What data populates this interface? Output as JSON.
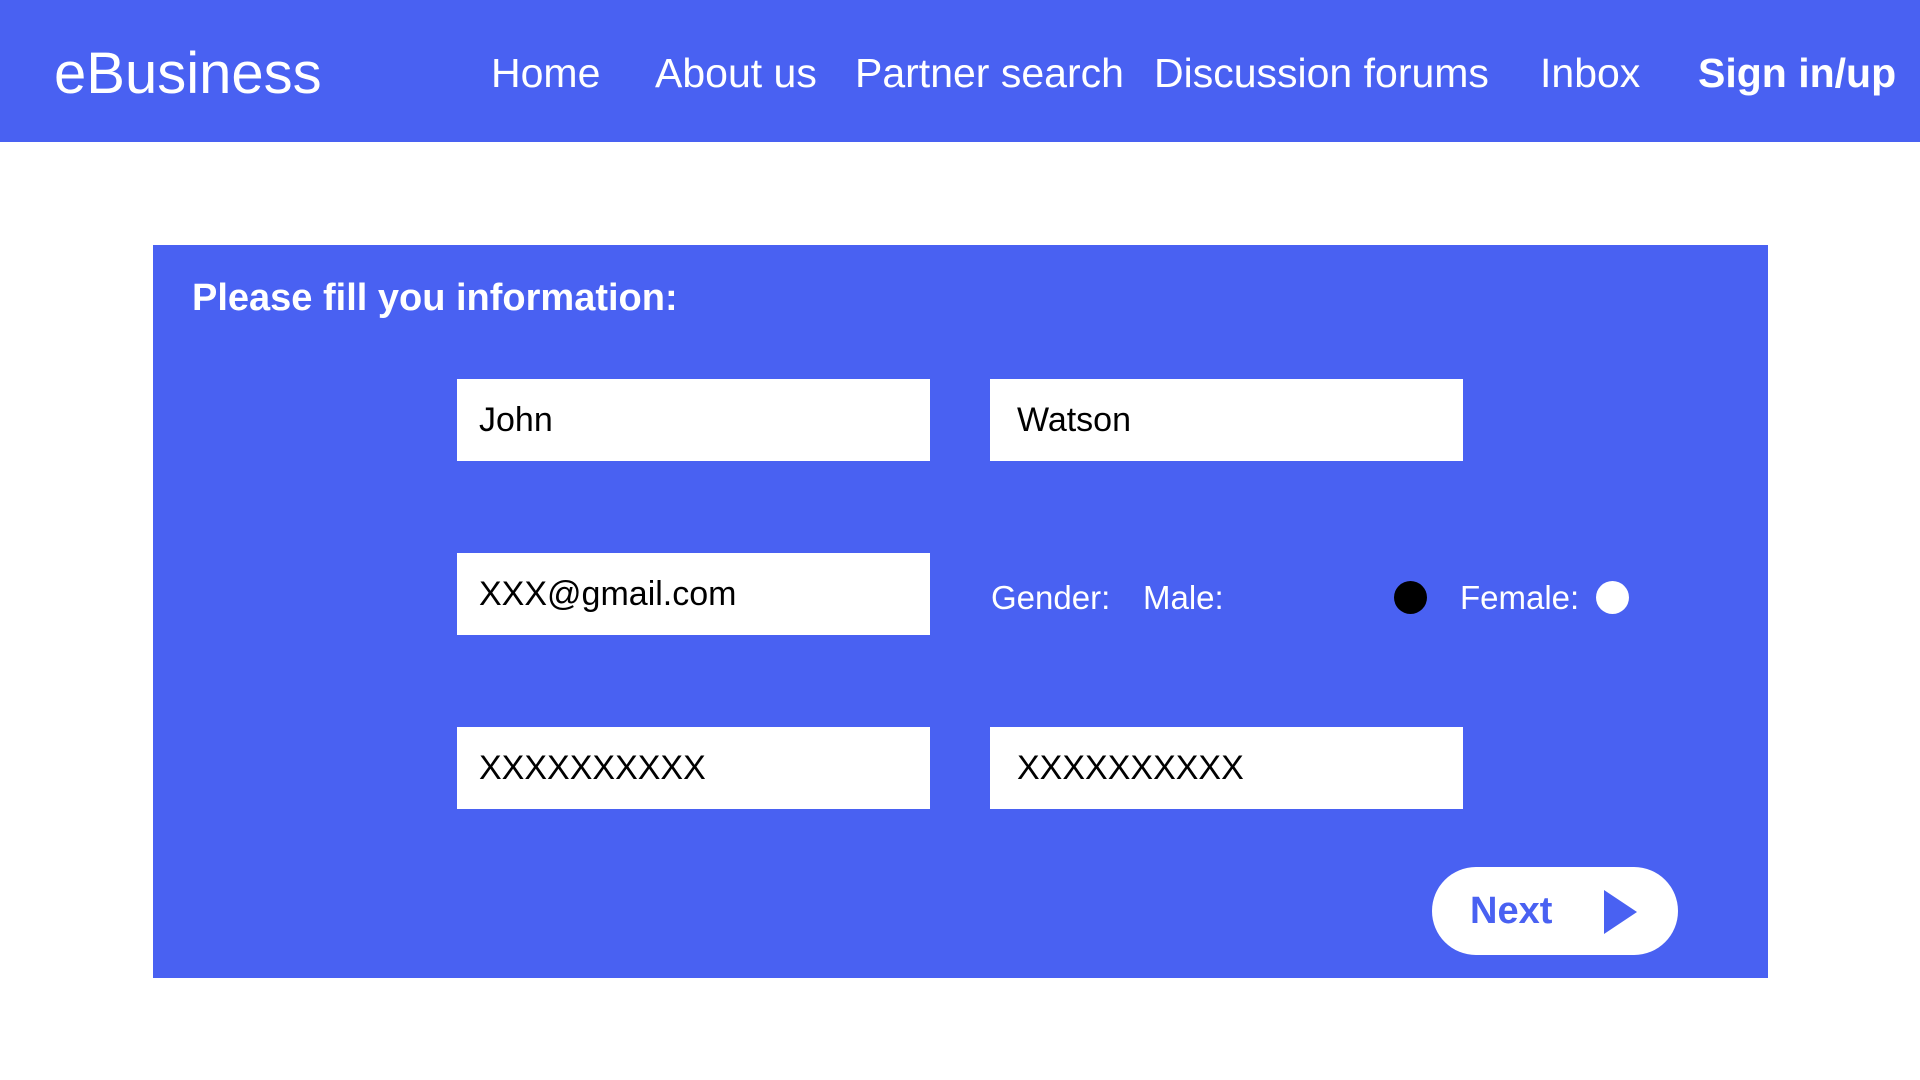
{
  "app": {
    "brand": "eBusiness"
  },
  "nav": {
    "items": [
      {
        "label": "Home"
      },
      {
        "label": "About us"
      },
      {
        "label": "Partner search"
      },
      {
        "label": "Discussion forums"
      },
      {
        "label": "Inbox"
      },
      {
        "label": "Sign in/up"
      }
    ]
  },
  "form": {
    "title": "Please fill you information:",
    "first_name": "John",
    "last_name": "Watson",
    "email": "XXX@gmail.com",
    "gender_label": "Gender:",
    "male_label": "Male:",
    "female_label": "Female:",
    "gender_selected": "male",
    "field_5": "XXXXXXXXXX",
    "field_6": "XXXXXXXXXX",
    "next_label": "Next"
  },
  "colors": {
    "primary": "#4961f2",
    "white": "#ffffff",
    "radio_selected": "#000000"
  },
  "icons": {
    "next": "play-arrow-icon"
  }
}
